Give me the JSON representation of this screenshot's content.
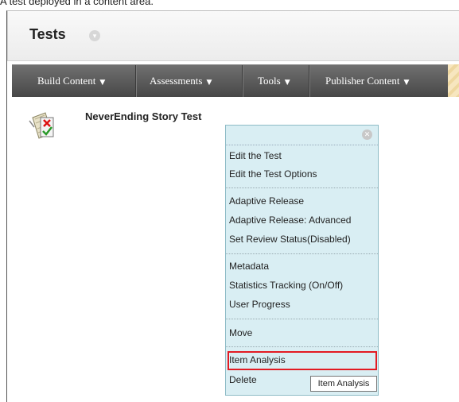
{
  "caption": "A test deployed in a content area.",
  "page": {
    "title": "Tests"
  },
  "navbar": {
    "items": [
      {
        "label": "Build Content"
      },
      {
        "label": "Assessments"
      },
      {
        "label": "Tools"
      },
      {
        "label": "Publisher Content"
      }
    ]
  },
  "content_item": {
    "title": "NeverEnding Story Test",
    "icon": "test-document-icon"
  },
  "context_menu": {
    "groups": [
      [
        "Edit the Test",
        "Edit the Test Options"
      ],
      [
        "Adaptive Release",
        "Adaptive Release: Advanced",
        "Set Review Status(Disabled)"
      ],
      [
        "Metadata",
        "Statistics Tracking (On/Off)",
        "User Progress"
      ],
      [
        "Move"
      ],
      [
        "Item Analysis",
        "Delete"
      ]
    ],
    "highlighted": "Item Analysis"
  },
  "tooltip": {
    "text": "Item Analysis"
  },
  "colors": {
    "highlight": "#e31b23",
    "menu_bg": "#d9eef3",
    "navbar": "#5a5a5a"
  }
}
